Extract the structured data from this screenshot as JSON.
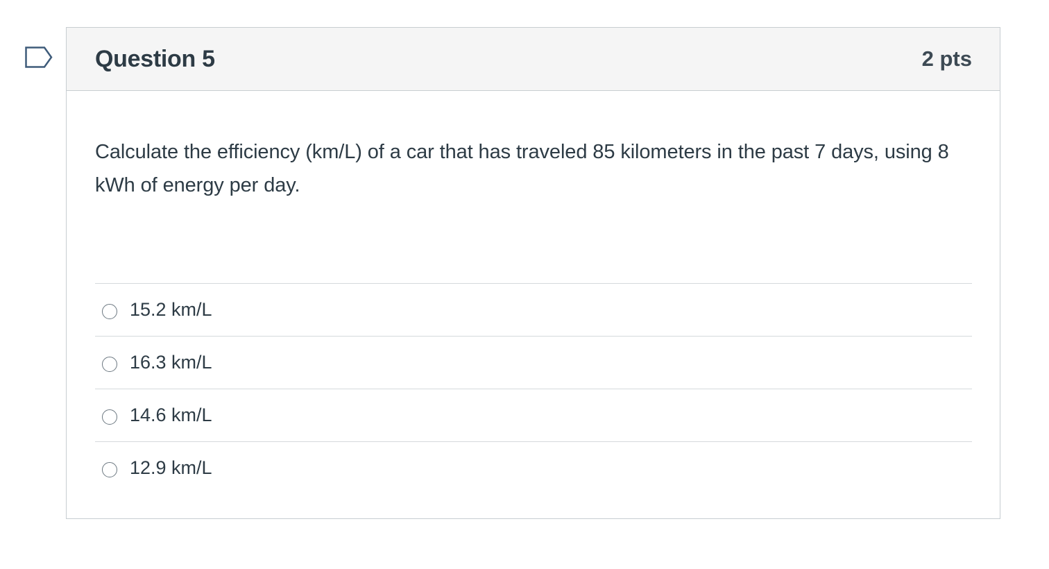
{
  "flag": {
    "icon": "bookmark-flag-icon",
    "color": "#3e5b7a"
  },
  "question": {
    "title": "Question 5",
    "points": "2 pts",
    "text": "Calculate the efficiency (km/L) of a car that has traveled 85 kilometers in the past 7 days, using 8 kWh of energy per day."
  },
  "answers": [
    {
      "label": "15.2 km/L"
    },
    {
      "label": "16.3 km/L"
    },
    {
      "label": "14.6 km/L"
    },
    {
      "label": "12.9 km/L"
    }
  ],
  "colors": {
    "text": "#2d3b45",
    "header_bg": "#f5f5f5",
    "border": "#c7cdd1"
  }
}
